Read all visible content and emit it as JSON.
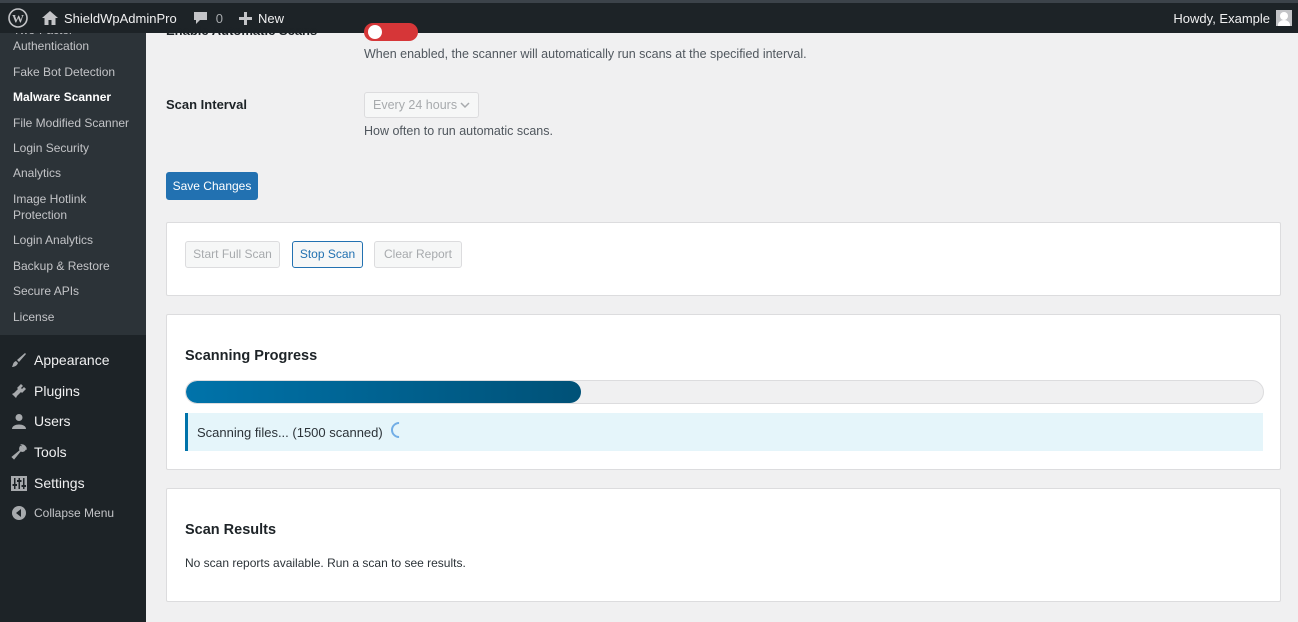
{
  "adminbar": {
    "site_name": "ShieldWpAdminPro",
    "comment_count": "0",
    "new_label": "New",
    "howdy": "Howdy, Example"
  },
  "sidebar": {
    "submenu": [
      {
        "label": "Two-Factor Authentication"
      },
      {
        "label": "Fake Bot Detection"
      },
      {
        "label": "Malware Scanner",
        "current": true
      },
      {
        "label": "File Modified Scanner"
      },
      {
        "label": "Login Security"
      },
      {
        "label": "Analytics"
      },
      {
        "label": "Image Hotlink Protection"
      },
      {
        "label": "Login Analytics"
      },
      {
        "label": "Backup & Restore"
      },
      {
        "label": "Secure APIs"
      },
      {
        "label": "License"
      }
    ],
    "menu": [
      {
        "label": "Appearance",
        "icon": "brush-icon"
      },
      {
        "label": "Plugins",
        "icon": "plug-icon"
      },
      {
        "label": "Users",
        "icon": "user-icon"
      },
      {
        "label": "Tools",
        "icon": "wrench-icon"
      },
      {
        "label": "Settings",
        "icon": "sliders-icon"
      }
    ],
    "collapse_label": "Collapse Menu"
  },
  "settings": {
    "auto_scan_label": "Enable Automatic Scans",
    "auto_scan_desc": "When enabled, the scanner will automatically run scans at the specified interval.",
    "interval_label": "Scan Interval",
    "interval_value": "Every 24 hours",
    "interval_desc": "How often to run automatic scans.",
    "save_label": "Save Changes"
  },
  "actions": {
    "start_label": "Start Full Scan",
    "stop_label": "Stop Scan",
    "clear_label": "Clear Report"
  },
  "progress": {
    "title": "Scanning Progress",
    "percent": 36.7,
    "status": "Scanning files... (1500 scanned)"
  },
  "results": {
    "title": "Scan Results",
    "empty_text": "No scan reports available. Run a scan to see results."
  },
  "colors": {
    "primary": "#2271b1",
    "progress": "#0073aa",
    "sidebar_bg": "#1d2327",
    "toggle_off": "#d63638"
  }
}
